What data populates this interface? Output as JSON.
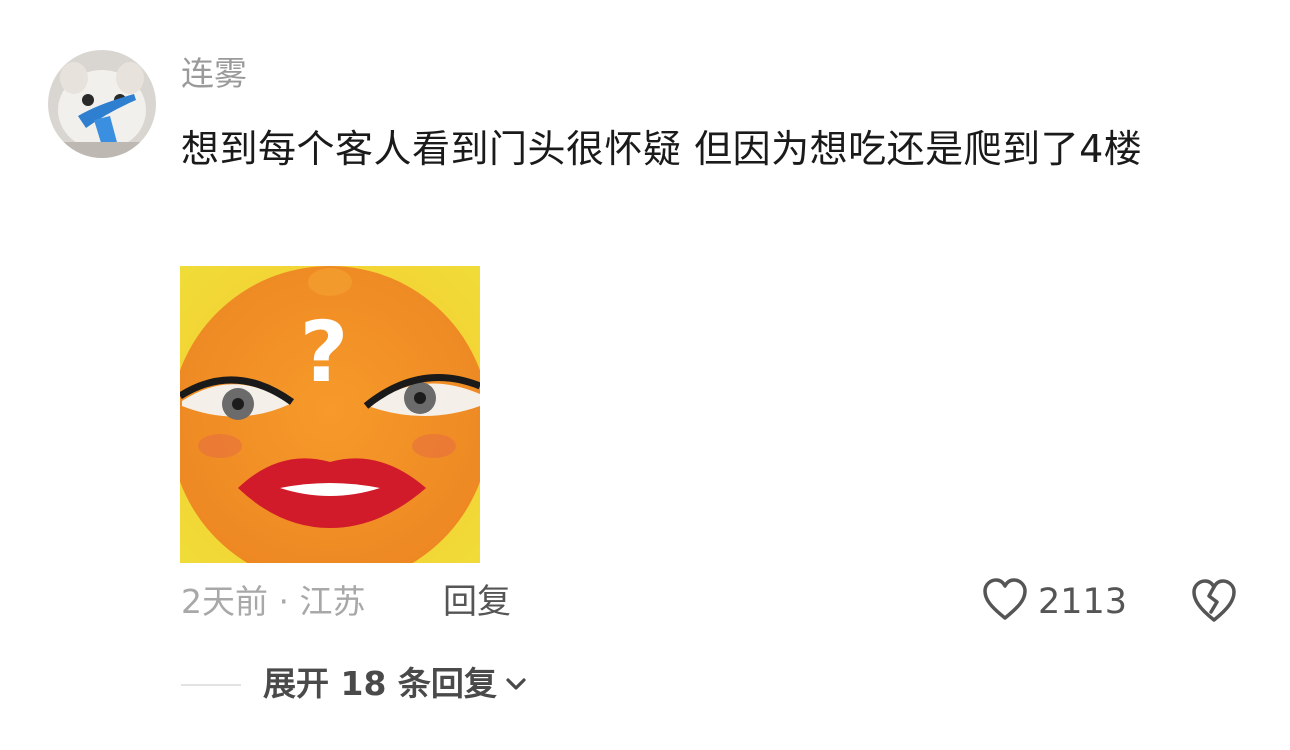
{
  "comment": {
    "username": "连雾",
    "text": "想到每个客人看到门头很怀疑 但因为想吃还是爬到了4楼",
    "meta": "2天前 · 江苏",
    "reply_label": "回复",
    "like_count": "2113",
    "expand_label": "展开 18 条回复"
  },
  "icons": {
    "avatar": "cat-avatar",
    "sticker": "orange-face-question-sticker",
    "like": "heart-outline-icon",
    "dislike": "broken-heart-icon",
    "expand": "chevron-down-icon"
  },
  "colors": {
    "username": "#9a9a9a",
    "text": "#1a1a1a",
    "meta": "#a8a8a8",
    "action": "#555555"
  }
}
